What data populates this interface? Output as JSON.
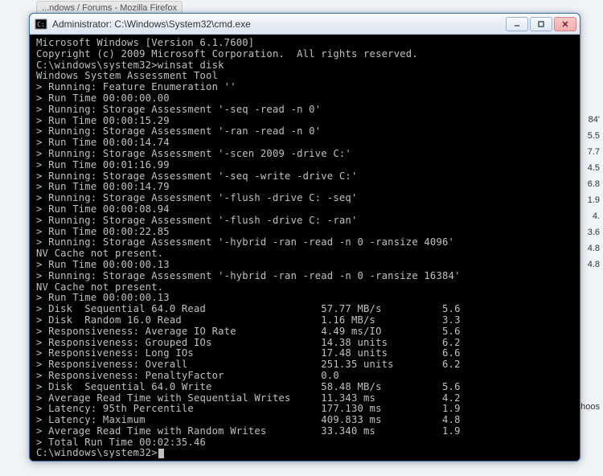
{
  "bg": {
    "tab": "...ndows / Forums - Mozilla Firefox",
    "right": [
      "84'",
      "",
      "5.5",
      "7.7",
      "4.5",
      "6.8",
      "1.9",
      "4.",
      "",
      "3.6",
      "4.8",
      "4.8"
    ],
    "choose": "choos"
  },
  "window": {
    "title": "Administrator: C:\\Windows\\System32\\cmd.exe",
    "minimize_tip": "Minimize",
    "maximize_tip": "Maximize",
    "close_tip": "Close"
  },
  "console": {
    "lines": [
      "Microsoft Windows [Version 6.1.7600]",
      "Copyright (c) 2009 Microsoft Corporation.  All rights reserved.",
      "",
      "C:\\windows\\system32>winsat disk",
      "Windows System Assessment Tool",
      "> Running: Feature Enumeration ''",
      "> Run Time 00:00:00.00",
      "> Running: Storage Assessment '-seq -read -n 0'",
      "> Run Time 00:00:15.29",
      "> Running: Storage Assessment '-ran -read -n 0'",
      "> Run Time 00:00:14.74",
      "> Running: Storage Assessment '-scen 2009 -drive C:'",
      "> Run Time 00:01:16.99",
      "> Running: Storage Assessment '-seq -write -drive C:'",
      "> Run Time 00:00:14.79",
      "> Running: Storage Assessment '-flush -drive C: -seq'",
      "> Run Time 00:00:08.94",
      "> Running: Storage Assessment '-flush -drive C: -ran'",
      "> Run Time 00:00:22.85",
      "> Running: Storage Assessment '-hybrid -ran -read -n 0 -ransize 4096'",
      "NV Cache not present.",
      "> Run Time 00:00:00.13",
      "> Running: Storage Assessment '-hybrid -ran -read -n 0 -ransize 16384'",
      "NV Cache not present.",
      "> Run Time 00:00:00.13",
      "> Disk  Sequential 64.0 Read                   57.77 MB/s          5.6",
      "> Disk  Random 16.0 Read                       1.16 MB/s           3.3",
      "> Responsiveness: Average IO Rate              4.49 ms/IO          5.6",
      "> Responsiveness: Grouped IOs                  14.38 units         6.2",
      "> Responsiveness: Long IOs                     17.48 units         6.6",
      "> Responsiveness: Overall                      251.35 units        6.2",
      "> Responsiveness: PenaltyFactor                0.0",
      "> Disk  Sequential 64.0 Write                  58.48 MB/s          5.6",
      "> Average Read Time with Sequential Writes     11.343 ms           4.2",
      "> Latency: 95th Percentile                     177.130 ms          1.9",
      "> Latency: Maximum                             409.833 ms          4.8",
      "> Average Read Time with Random Writes         33.340 ms           1.9",
      "> Total Run Time 00:02:35.46",
      "",
      "C:\\windows\\system32>"
    ]
  }
}
